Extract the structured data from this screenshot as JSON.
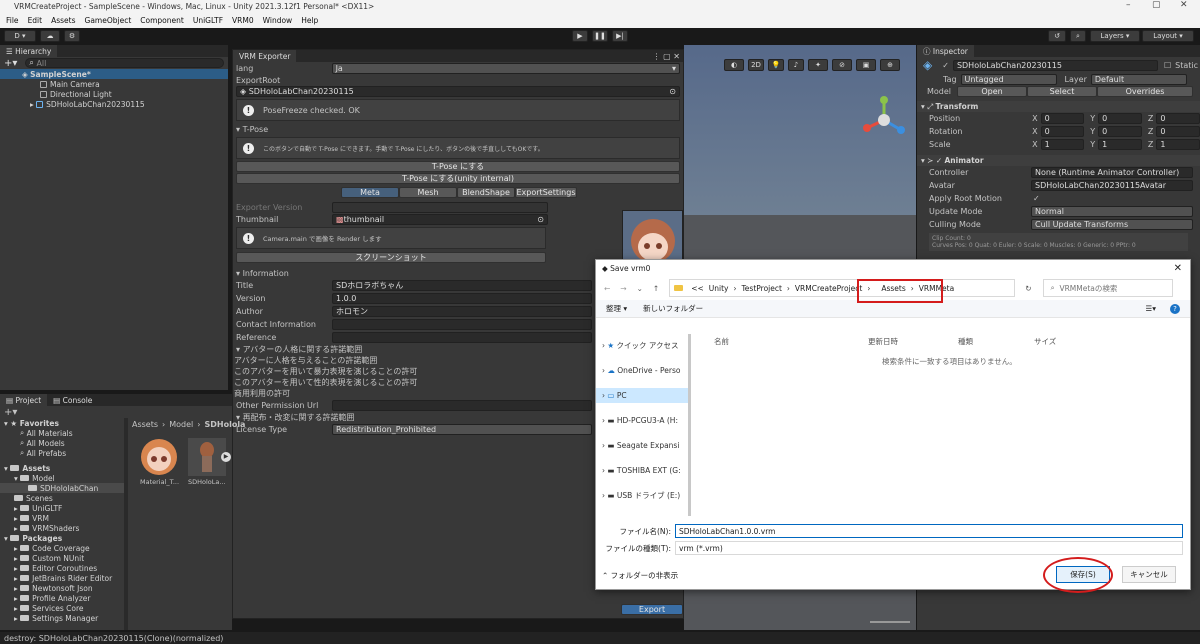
{
  "window": {
    "title": "VRMCreateProject - SampleScene - Windows, Mac, Linux - Unity 2021.3.12f1 Personal* <DX11>"
  },
  "menu": [
    "File",
    "Edit",
    "Assets",
    "GameObject",
    "Component",
    "UniGLTF",
    "VRM0",
    "Window",
    "Help"
  ],
  "toolbar": {
    "account": "D ▾",
    "layers": "Layers",
    "layout": "Layout"
  },
  "hierarchy": {
    "tab": "Hierarchy",
    "search_placeholder": "All",
    "items": [
      "SampleScene*",
      "Main Camera",
      "Directional Light",
      "SDHoloLabChan20230115"
    ]
  },
  "exporter": {
    "tab": "VRM Exporter",
    "lang_label": "lang",
    "lang_value": "Ja",
    "export_root_label": "ExportRoot",
    "export_root_value": "SDHoloLabChan20230115",
    "posefreeze_msg": "PoseFreeze checked. OK",
    "tpose_header": "T-Pose",
    "tpose_msg": "このボタンで自動で T-Pose にできます。手動で T-Pose にしたり、ボタンの後で手直ししてもOKです。",
    "tpose_btn": "T-Pose にする",
    "tpose_internal_btn": "T-Pose にする(unity internal)",
    "tabs": [
      "Meta",
      "Mesh",
      "BlendShape",
      "ExportSettings"
    ],
    "exporter_version_label": "Exporter Version",
    "thumbnail_label": "Thumbnail",
    "thumbnail_value": "thumbnail",
    "camera_msg": "Camera.main で画像を Render します",
    "screenshot_btn": "スクリーンショット",
    "information_header": "Information",
    "title_label": "Title",
    "title_value": "SDホロラボちゃん",
    "version_label": "Version",
    "version_value": "1.0.0",
    "author_label": "Author",
    "author_value": "ホロモン",
    "contact_label": "Contact Information",
    "reference_label": "Reference",
    "avatar_perm_header": "アバターの人格に関する許諾範囲",
    "perm1": "アバターに人格を与えることの許諾範囲",
    "perm2": "このアバターを用いて暴力表現を演じることの許可",
    "perm3": "このアバターを用いて性的表現を演じることの許可",
    "perm4": "商用利用の許可",
    "other_perm_label": "Other Permission Url",
    "redistribution_header": "再配布・改変に関する許諾範囲",
    "license_label": "License Type",
    "license_value": "Redistribution_Prohibited",
    "export_btn": "Export"
  },
  "scene": {
    "toolbar_2d": "2D"
  },
  "inspector": {
    "tab": "Inspector",
    "object_name": "SDHoloLabChan20230115",
    "static_label": "Static",
    "tag_label": "Tag",
    "tag_value": "Untagged",
    "layer_label": "Layer",
    "layer_value": "Default",
    "model_label": "Model",
    "model_buttons": [
      "Open",
      "Select",
      "Overrides"
    ],
    "transform_header": "Transform",
    "transform_rows": [
      {
        "label": "Position",
        "x": "0",
        "y": "0",
        "z": "0"
      },
      {
        "label": "Rotation",
        "x": "0",
        "y": "0",
        "z": "0"
      },
      {
        "label": "Scale",
        "x": "1",
        "y": "1",
        "z": "1"
      }
    ],
    "animator_header": "Animator",
    "animator_rows": [
      {
        "label": "Controller",
        "value": "None (Runtime Animator Controller)"
      },
      {
        "label": "Avatar",
        "value": "SDHoloLabChan20230115Avatar"
      },
      {
        "label": "Apply Root Motion",
        "value": "✓"
      },
      {
        "label": "Update Mode",
        "value": "Normal"
      },
      {
        "label": "Culling Mode",
        "value": "Cull Update Transforms"
      }
    ],
    "clip_info": [
      "Clip Count: 0",
      "Curves Pos: 0 Quat: 0 Euler: 0 Scale: 0 Muscles: 0 Generic: 0 PPtr: 0"
    ]
  },
  "project": {
    "tabs": [
      "Project",
      "Console"
    ],
    "favorites_label": "Favorites",
    "favorites": [
      "All Materials",
      "All Models",
      "All Prefabs"
    ],
    "assets_label": "Assets",
    "tree": [
      {
        "label": "Model",
        "indent": 1
      },
      {
        "label": "SDHololabChan",
        "indent": 2
      },
      {
        "label": "Scenes",
        "indent": 1
      },
      {
        "label": "UniGLTF",
        "indent": 1
      },
      {
        "label": "VRM",
        "indent": 1
      },
      {
        "label": "VRMShaders",
        "indent": 1
      }
    ],
    "packages_label": "Packages",
    "packages": [
      "Code Coverage",
      "Custom NUnit",
      "Editor Coroutines",
      "JetBrains Rider Editor",
      "Newtonsoft Json",
      "Profile Analyzer",
      "Services Core",
      "Settings Manager"
    ],
    "breadcrumb": [
      "Assets",
      "Model",
      "SDHolola"
    ],
    "files": [
      "Material_T...",
      "SDHoloLa..."
    ]
  },
  "status": {
    "message": "destroy: SDHoloLabChan20230115(Clone)(normalized)"
  },
  "dialog": {
    "title": "Save vrm0",
    "path": [
      "<<",
      "Unity",
      "TestProject",
      "VRMCreateProject",
      "Assets",
      "VRMMeta"
    ],
    "search_placeholder": "VRMMetaの検索",
    "organize": "整理 ▾",
    "new_folder": "新しいフォルダー",
    "columns": [
      "名前",
      "更新日時",
      "種類",
      "サイズ"
    ],
    "empty_msg": "検索条件に一致する項目はありません。",
    "nav": [
      "クイック アクセス",
      "OneDrive - Perso",
      "PC",
      "HD-PCGU3-A (H:",
      "Seagate Expansi",
      "TOSHIBA EXT (G:",
      "USB ドライブ (E:)"
    ],
    "filename_label": "ファイル名(N):",
    "filename_value": "SDHoloLabChan1.0.0.vrm",
    "filetype_label": "ファイルの種類(T):",
    "filetype_value": "vrm (*.vrm)",
    "hide_folders": "フォルダーの非表示",
    "save_btn": "保存(S)",
    "cancel_btn": "キャンセル"
  }
}
